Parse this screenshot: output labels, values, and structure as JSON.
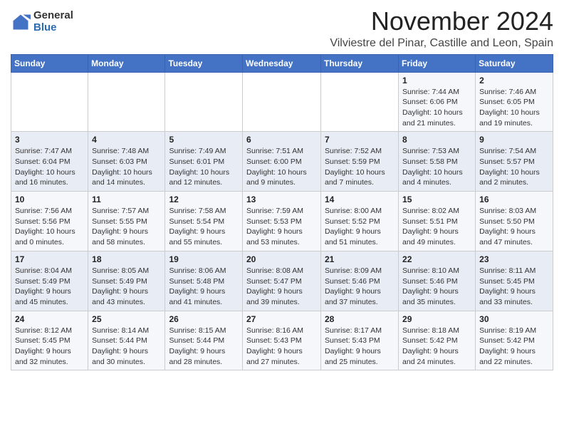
{
  "logo": {
    "general": "General",
    "blue": "Blue"
  },
  "title": {
    "month": "November 2024",
    "location": "Vilviestre del Pinar, Castille and Leon, Spain"
  },
  "headers": [
    "Sunday",
    "Monday",
    "Tuesday",
    "Wednesday",
    "Thursday",
    "Friday",
    "Saturday"
  ],
  "weeks": [
    [
      {
        "day": "",
        "info": ""
      },
      {
        "day": "",
        "info": ""
      },
      {
        "day": "",
        "info": ""
      },
      {
        "day": "",
        "info": ""
      },
      {
        "day": "",
        "info": ""
      },
      {
        "day": "1",
        "info": "Sunrise: 7:44 AM\nSunset: 6:06 PM\nDaylight: 10 hours and 21 minutes."
      },
      {
        "day": "2",
        "info": "Sunrise: 7:46 AM\nSunset: 6:05 PM\nDaylight: 10 hours and 19 minutes."
      }
    ],
    [
      {
        "day": "3",
        "info": "Sunrise: 7:47 AM\nSunset: 6:04 PM\nDaylight: 10 hours and 16 minutes."
      },
      {
        "day": "4",
        "info": "Sunrise: 7:48 AM\nSunset: 6:03 PM\nDaylight: 10 hours and 14 minutes."
      },
      {
        "day": "5",
        "info": "Sunrise: 7:49 AM\nSunset: 6:01 PM\nDaylight: 10 hours and 12 minutes."
      },
      {
        "day": "6",
        "info": "Sunrise: 7:51 AM\nSunset: 6:00 PM\nDaylight: 10 hours and 9 minutes."
      },
      {
        "day": "7",
        "info": "Sunrise: 7:52 AM\nSunset: 5:59 PM\nDaylight: 10 hours and 7 minutes."
      },
      {
        "day": "8",
        "info": "Sunrise: 7:53 AM\nSunset: 5:58 PM\nDaylight: 10 hours and 4 minutes."
      },
      {
        "day": "9",
        "info": "Sunrise: 7:54 AM\nSunset: 5:57 PM\nDaylight: 10 hours and 2 minutes."
      }
    ],
    [
      {
        "day": "10",
        "info": "Sunrise: 7:56 AM\nSunset: 5:56 PM\nDaylight: 10 hours and 0 minutes."
      },
      {
        "day": "11",
        "info": "Sunrise: 7:57 AM\nSunset: 5:55 PM\nDaylight: 9 hours and 58 minutes."
      },
      {
        "day": "12",
        "info": "Sunrise: 7:58 AM\nSunset: 5:54 PM\nDaylight: 9 hours and 55 minutes."
      },
      {
        "day": "13",
        "info": "Sunrise: 7:59 AM\nSunset: 5:53 PM\nDaylight: 9 hours and 53 minutes."
      },
      {
        "day": "14",
        "info": "Sunrise: 8:00 AM\nSunset: 5:52 PM\nDaylight: 9 hours and 51 minutes."
      },
      {
        "day": "15",
        "info": "Sunrise: 8:02 AM\nSunset: 5:51 PM\nDaylight: 9 hours and 49 minutes."
      },
      {
        "day": "16",
        "info": "Sunrise: 8:03 AM\nSunset: 5:50 PM\nDaylight: 9 hours and 47 minutes."
      }
    ],
    [
      {
        "day": "17",
        "info": "Sunrise: 8:04 AM\nSunset: 5:49 PM\nDaylight: 9 hours and 45 minutes."
      },
      {
        "day": "18",
        "info": "Sunrise: 8:05 AM\nSunset: 5:49 PM\nDaylight: 9 hours and 43 minutes."
      },
      {
        "day": "19",
        "info": "Sunrise: 8:06 AM\nSunset: 5:48 PM\nDaylight: 9 hours and 41 minutes."
      },
      {
        "day": "20",
        "info": "Sunrise: 8:08 AM\nSunset: 5:47 PM\nDaylight: 9 hours and 39 minutes."
      },
      {
        "day": "21",
        "info": "Sunrise: 8:09 AM\nSunset: 5:46 PM\nDaylight: 9 hours and 37 minutes."
      },
      {
        "day": "22",
        "info": "Sunrise: 8:10 AM\nSunset: 5:46 PM\nDaylight: 9 hours and 35 minutes."
      },
      {
        "day": "23",
        "info": "Sunrise: 8:11 AM\nSunset: 5:45 PM\nDaylight: 9 hours and 33 minutes."
      }
    ],
    [
      {
        "day": "24",
        "info": "Sunrise: 8:12 AM\nSunset: 5:45 PM\nDaylight: 9 hours and 32 minutes."
      },
      {
        "day": "25",
        "info": "Sunrise: 8:14 AM\nSunset: 5:44 PM\nDaylight: 9 hours and 30 minutes."
      },
      {
        "day": "26",
        "info": "Sunrise: 8:15 AM\nSunset: 5:44 PM\nDaylight: 9 hours and 28 minutes."
      },
      {
        "day": "27",
        "info": "Sunrise: 8:16 AM\nSunset: 5:43 PM\nDaylight: 9 hours and 27 minutes."
      },
      {
        "day": "28",
        "info": "Sunrise: 8:17 AM\nSunset: 5:43 PM\nDaylight: 9 hours and 25 minutes."
      },
      {
        "day": "29",
        "info": "Sunrise: 8:18 AM\nSunset: 5:42 PM\nDaylight: 9 hours and 24 minutes."
      },
      {
        "day": "30",
        "info": "Sunrise: 8:19 AM\nSunset: 5:42 PM\nDaylight: 9 hours and 22 minutes."
      }
    ]
  ]
}
